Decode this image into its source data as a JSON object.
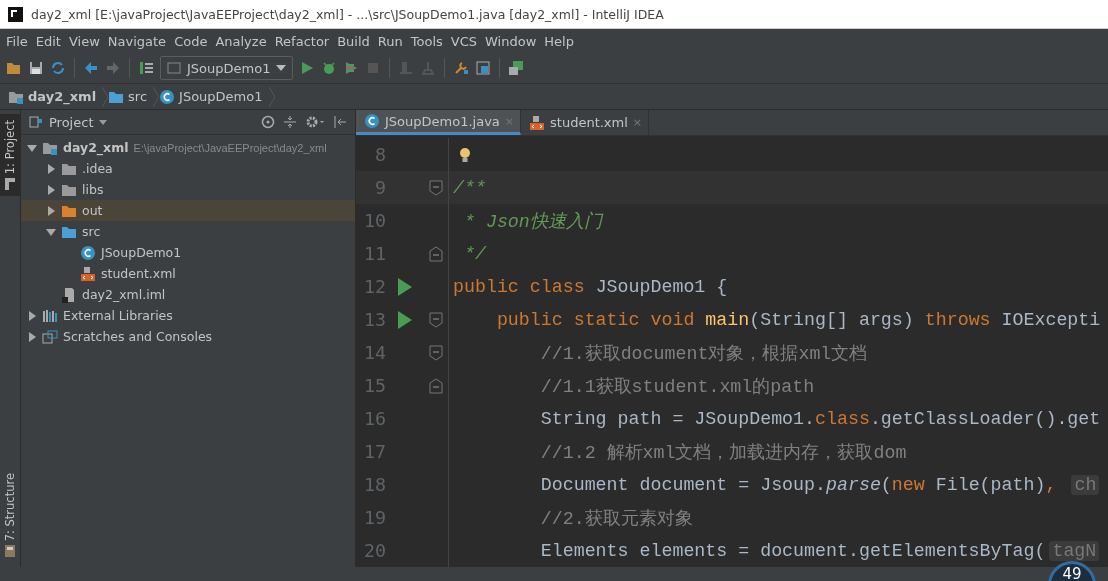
{
  "window": {
    "title": "day2_xml [E:\\javaProject\\JavaEEProject\\day2_xml] - ...\\src\\JSoupDemo1.java [day2_xml] - IntelliJ IDEA"
  },
  "menu": [
    "File",
    "Edit",
    "View",
    "Navigate",
    "Code",
    "Analyze",
    "Refactor",
    "Build",
    "Run",
    "Tools",
    "VCS",
    "Window",
    "Help"
  ],
  "toolbar": {
    "run_config": "JSoupDemo1"
  },
  "breadcrumbs": [
    {
      "label": "day2_xml",
      "kind": "module"
    },
    {
      "label": "src",
      "kind": "folder"
    },
    {
      "label": "JSoupDemo1",
      "kind": "class"
    }
  ],
  "side_tabs": [
    {
      "label": "1: Project",
      "selected": true
    },
    {
      "label": "7: Structure",
      "selected": false
    }
  ],
  "project_panel": {
    "title": "Project",
    "tree": [
      {
        "label": "day2_xml",
        "kind": "module",
        "path": "E:\\javaProject\\JavaEEProject\\day2_xml",
        "expanded": true,
        "selected": false,
        "children": [
          {
            "label": ".idea",
            "kind": "folder",
            "color": "#9a9a9a",
            "expanded": false,
            "selected": false
          },
          {
            "label": "libs",
            "kind": "folder",
            "color": "#9a9a9a",
            "expanded": false,
            "selected": false
          },
          {
            "label": "out",
            "kind": "folder",
            "color": "#d9822b",
            "expanded": false,
            "selected": true
          },
          {
            "label": "src",
            "kind": "folder",
            "color": "#4b9fd5",
            "expanded": true,
            "selected": false,
            "children": [
              {
                "label": "JSoupDemo1",
                "kind": "class",
                "selected": false
              },
              {
                "label": "student.xml",
                "kind": "xml",
                "selected": false
              }
            ]
          },
          {
            "label": "day2_xml.iml",
            "kind": "iml",
            "selected": false
          }
        ]
      },
      {
        "label": "External Libraries",
        "kind": "libraries",
        "expanded": false,
        "selected": false
      },
      {
        "label": "Scratches and Consoles",
        "kind": "scratches",
        "expanded": false,
        "selected": false
      }
    ]
  },
  "editor": {
    "tabs": [
      {
        "label": "JSoupDemo1.java",
        "kind": "class",
        "selected": true,
        "close": "×"
      },
      {
        "label": "student.xml",
        "kind": "xml",
        "selected": false,
        "close": "×"
      }
    ],
    "lines": [
      {
        "number": "8",
        "bulb": true
      },
      {
        "number": "9",
        "fold_start": true,
        "current": true,
        "segments": [
          {
            "kind": "doc",
            "text": "/**"
          }
        ]
      },
      {
        "number": "10",
        "segments": [
          {
            "kind": "doc",
            "text": " * Json快速入门"
          }
        ]
      },
      {
        "number": "11",
        "fold_end": true,
        "segments": [
          {
            "kind": "doc",
            "text": " */"
          }
        ]
      },
      {
        "number": "12",
        "run": true,
        "segments": [
          {
            "kind": "keyword",
            "text": "public class "
          },
          {
            "kind": "plain",
            "text": "JSoupDemo1 {"
          }
        ]
      },
      {
        "number": "13",
        "run": true,
        "fold_start": true,
        "segments": [
          {
            "kind": "keyword",
            "text": "    public static void "
          },
          {
            "kind": "method",
            "text": "main"
          },
          {
            "kind": "plain",
            "text": "(String[] args) "
          },
          {
            "kind": "keyword",
            "text": "throws "
          },
          {
            "kind": "plain",
            "text": "IOExcepti"
          }
        ]
      },
      {
        "number": "14",
        "fold_start": true,
        "segments": [
          {
            "kind": "comment",
            "text": "        //1.获取document对象，根据xml文档"
          }
        ]
      },
      {
        "number": "15",
        "fold_end": true,
        "segments": [
          {
            "kind": "comment",
            "text": "        //1.1获取student.xml的path"
          }
        ]
      },
      {
        "number": "16",
        "segments": [
          {
            "kind": "plain",
            "text": "        String path = JSoupDemo1."
          },
          {
            "kind": "keyword",
            "text": "class"
          },
          {
            "kind": "plain",
            "text": ".getClassLoader().get"
          }
        ]
      },
      {
        "number": "17",
        "segments": [
          {
            "kind": "comment",
            "text": "        //1.2 解析xml文档，加载进内存，获取dom"
          }
        ]
      },
      {
        "number": "18",
        "segments": [
          {
            "kind": "plain",
            "text": "        Document document = Jsoup."
          },
          {
            "kind": "static",
            "text": "parse"
          },
          {
            "kind": "plain",
            "text": "("
          },
          {
            "kind": "keyword",
            "text": "new "
          },
          {
            "kind": "plain",
            "text": "File(path)"
          },
          {
            "kind": "keyword",
            "text": ", "
          },
          {
            "kind": "hint",
            "text": "ch"
          }
        ]
      },
      {
        "number": "19",
        "segments": [
          {
            "kind": "comment",
            "text": "        //2.获取元素对象"
          }
        ]
      },
      {
        "number": "20",
        "segments": [
          {
            "kind": "plain",
            "text": "        Elements elements = document.getElementsByTag("
          },
          {
            "kind": "hint",
            "text": "tagN"
          }
        ]
      }
    ]
  },
  "floating_badge": {
    "text": "49"
  }
}
